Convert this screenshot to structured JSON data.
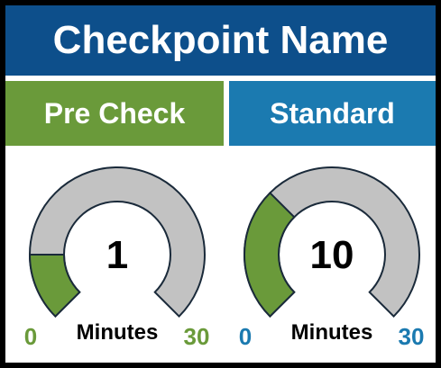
{
  "header": {
    "title": "Checkpoint Name"
  },
  "tabs": [
    {
      "label": "Pre Check",
      "color": "#6a9a3a"
    },
    {
      "label": "Standard",
      "color": "#1b7ab0"
    }
  ],
  "gauges": [
    {
      "value": "1",
      "min": "0",
      "max": "30",
      "unit": "Minutes",
      "fill_fraction": 0.1667,
      "accent": "#6a9a3a"
    },
    {
      "value": "10",
      "min": "0",
      "max": "30",
      "unit": "Minutes",
      "fill_fraction": 0.3333,
      "accent": "#6a9a3a",
      "label_color": "#1b7ab0"
    }
  ],
  "colors": {
    "track": "#c2c2c2",
    "outline": "#1a2a3a",
    "title_bg": "#0d4f8b"
  }
}
